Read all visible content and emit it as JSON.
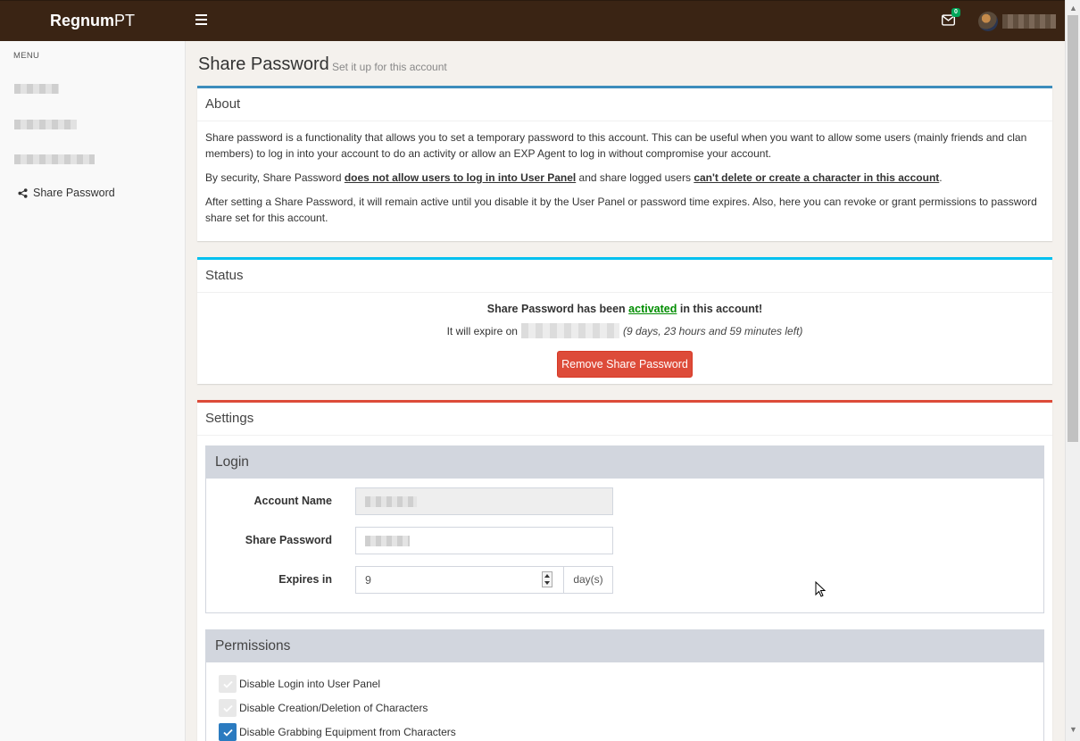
{
  "header": {
    "brand_bold": "Regnum",
    "brand_light": "PT",
    "mail_count": "0"
  },
  "sidebar": {
    "menu_title": "MENU",
    "active_item": "Share Password"
  },
  "page": {
    "title": "Share Password",
    "subtitle": "Set it up for this account"
  },
  "about": {
    "title": "About",
    "p1": "Share password is a functionality that allows you to set a temporary password to this account. This can be useful when you want to allow some users (mainly friends and clan members) to log in into your account to do an activity or allow an EXP Agent to log in without compromise your account.",
    "p2_a": "By security, Share Password ",
    "p2_b": "does not allow users to log in into User Panel",
    "p2_c": " and share logged users ",
    "p2_d": "can't delete or create a character in this account",
    "p2_e": ".",
    "p3": "After setting a Share Password, it will remain active until you disable it by the User Panel or password time expires. Also, here you can revoke or grant permissions to password share set for this account."
  },
  "status": {
    "title": "Status",
    "line1_a": "Share Password has been ",
    "line1_link": "activated",
    "line1_b": " in this account!",
    "line2_a": "It will expire on",
    "line2_b": "(9 days, 23 hours and 59 minutes left)",
    "remove_label": "Remove Share Password"
  },
  "settings": {
    "title": "Settings",
    "login": {
      "title": "Login",
      "account_label": "Account Name",
      "password_label": "Share Password",
      "expires_label": "Expires in",
      "expires_value": "9",
      "expires_unit": "day(s)"
    },
    "permissions": {
      "title": "Permissions",
      "items": [
        {
          "label": "Disable Login into User Panel",
          "checked": false
        },
        {
          "label": "Disable Creation/Deletion of Characters",
          "checked": false
        },
        {
          "label": "Disable Grabbing Equipment from Characters",
          "checked": true
        }
      ]
    }
  },
  "colors": {
    "topbar": "#3a2414",
    "about_accent": "#3c8dbc",
    "status_accent": "#00c0ef",
    "settings_accent": "#dd4b39",
    "danger": "#dd4b39",
    "success_link": "#008d00",
    "checkbox_on": "#2b7bc0"
  }
}
